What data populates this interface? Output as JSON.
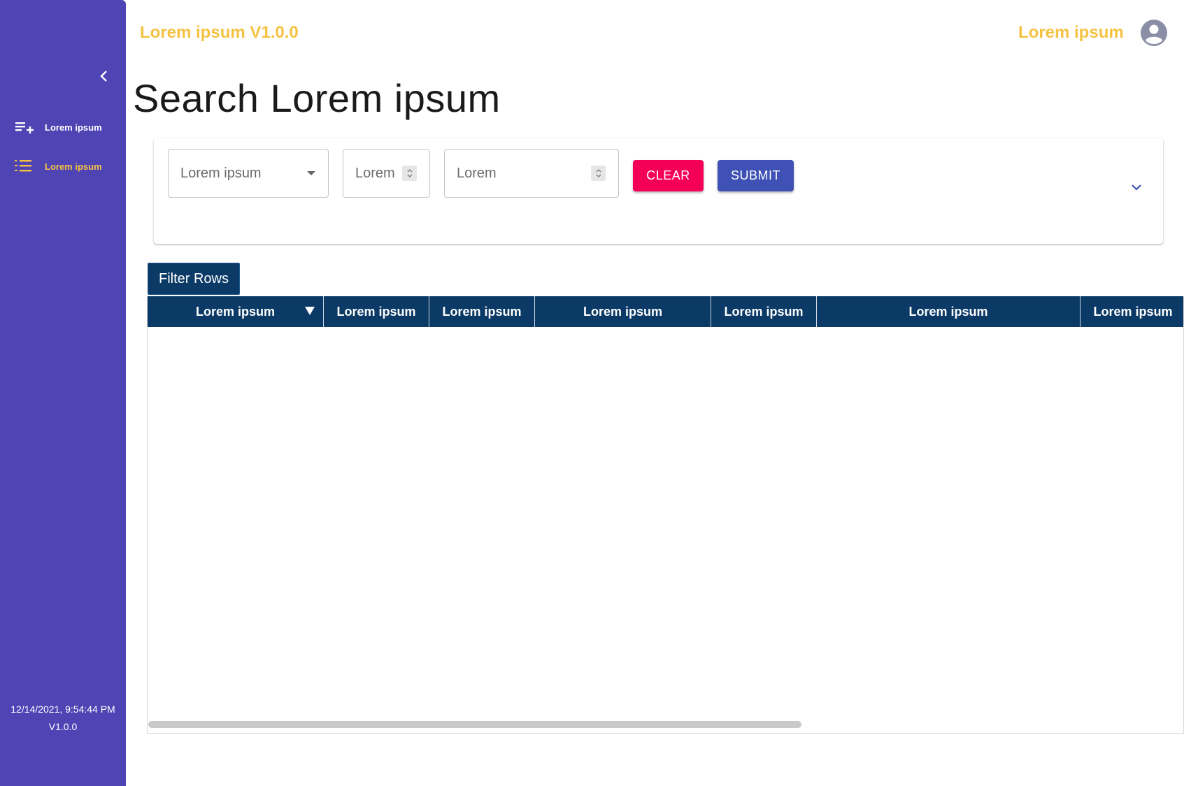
{
  "sidebar": {
    "collapse_icon": "chevron-left-icon",
    "items": [
      {
        "label": "Lorem ipsum",
        "icon": "playlist-add-icon",
        "active": false
      },
      {
        "label": "Lorem ipsum",
        "icon": "format-list-numbered-icon",
        "active": true
      }
    ],
    "footer": {
      "timestamp": "12/14/2021, 9:54:44 PM",
      "version": "V1.0.0"
    }
  },
  "header": {
    "app_title": "Lorem ipsum V1.0.0",
    "user_name": "Lorem ipsum",
    "avatar_icon": "account-circle-icon"
  },
  "page": {
    "title": "Search Lorem ipsum"
  },
  "search_form": {
    "select_value": "Lorem ipsum",
    "number_field_1": "Lorem",
    "number_field_2": "Lorem",
    "clear_label": "CLEAR",
    "submit_label": "SUBMIT",
    "expand_icon": "chevron-down-icon"
  },
  "grid": {
    "filter_label": "Filter Rows",
    "columns": [
      "Lorem ipsum",
      "Lorem ipsum",
      "Lorem ipsum",
      "Lorem ipsum",
      "Lorem ipsum",
      "Lorem ipsum",
      "Lorem ipsum"
    ],
    "rows": []
  },
  "colors": {
    "sidebar_bg": "#4f44b4",
    "accent_yellow": "#f5c242",
    "clear_button": "#f50057",
    "submit_button": "#3f51b5",
    "grid_header": "#0b3a66"
  }
}
